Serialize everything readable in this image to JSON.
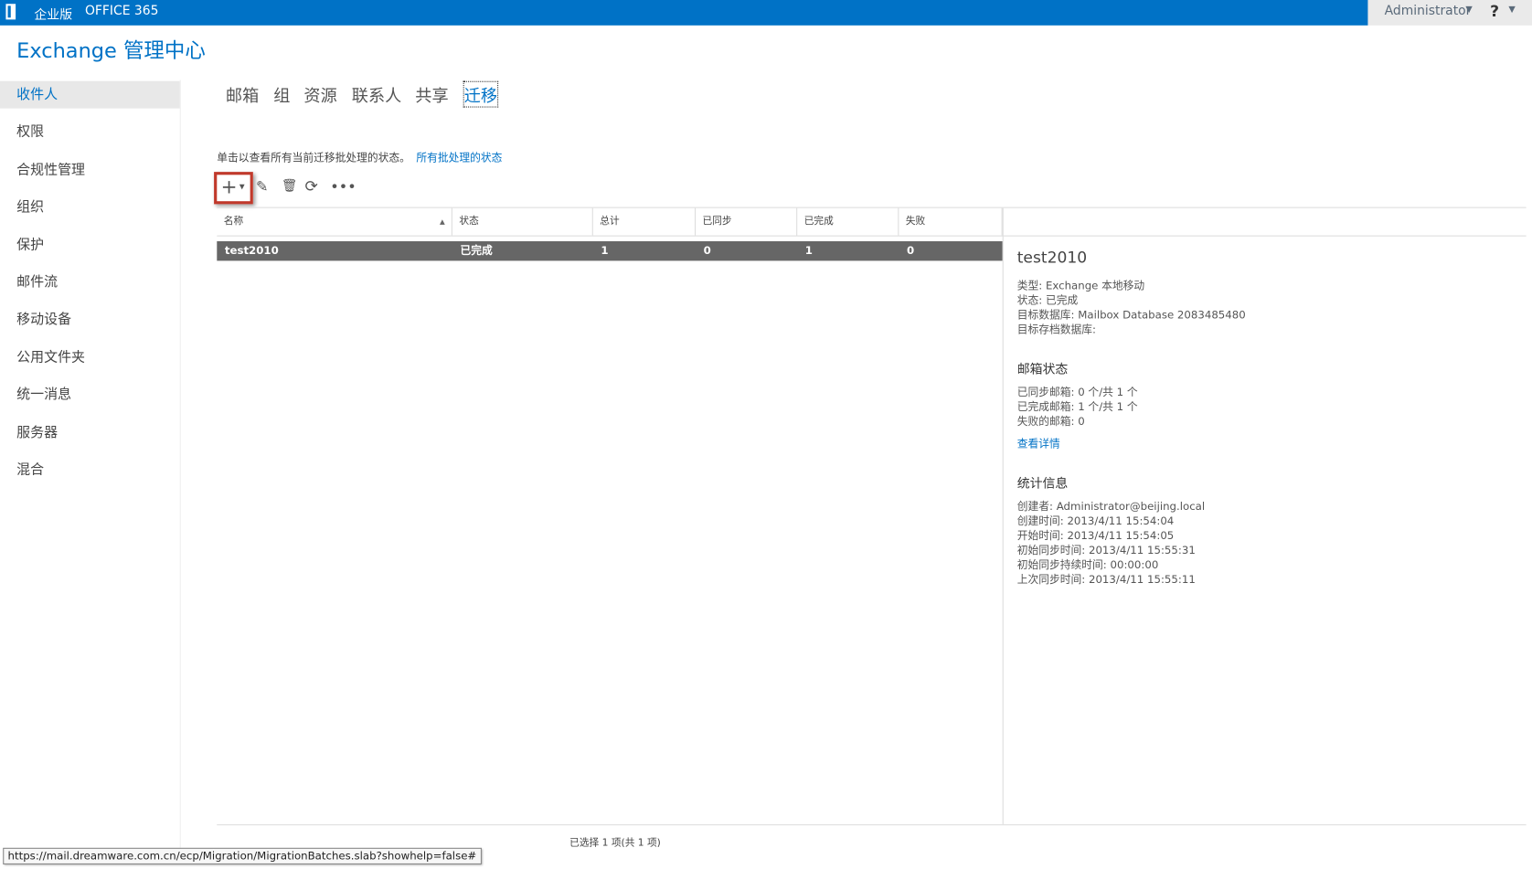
{
  "topbar": {
    "edition": "企业版",
    "product": "OFFICE 365",
    "user": "Administrator",
    "help": "?"
  },
  "title": "Exchange 管理中心",
  "sidebar": [
    "收件人",
    "权限",
    "合规性管理",
    "组织",
    "保护",
    "邮件流",
    "移动设备",
    "公用文件夹",
    "统一消息",
    "服务器",
    "混合"
  ],
  "tabs": [
    "邮箱",
    "组",
    "资源",
    "联系人",
    "共享",
    "迁移"
  ],
  "hint": {
    "text": "单击以查看所有当前迁移批处理的状态。",
    "link": "所有批处理的状态"
  },
  "table": {
    "headers": [
      "名称",
      "状态",
      "总计",
      "已同步",
      "已完成",
      "失败"
    ],
    "rows": [
      [
        "test2010",
        "已完成",
        "1",
        "0",
        "1",
        "0"
      ]
    ]
  },
  "detail": {
    "name": "test2010",
    "type": "类型: Exchange 本地移动",
    "status": "状态: 已完成",
    "target_db": "目标数据库: Mailbox Database 2083485480",
    "archive_db": "目标存档数据库:",
    "mailbox_title": "邮箱状态",
    "synced": "已同步邮箱: 0 个/共 1 个",
    "completed": "已完成邮箱: 1 个/共 1 个",
    "failed": "失败的邮箱: 0",
    "details_link": "查看详情",
    "stats_title": "统计信息",
    "creator": "创建者: Administrator@beijing.local",
    "created": "创建时间: 2013/4/11 15:54:04",
    "started": "开始时间: 2013/4/11 15:54:05",
    "init_sync": "初始同步时间: 2013/4/11 15:55:31",
    "init_duration": "初始同步持续时间: 00:00:00",
    "last_sync": "上次同步时间: 2013/4/11 15:55:11"
  },
  "footer": "已选择 1 项(共 1 项)",
  "statusbar": "https://mail.dreamware.com.cn/ecp/Migration/MigrationBatches.slab?showhelp=false#"
}
